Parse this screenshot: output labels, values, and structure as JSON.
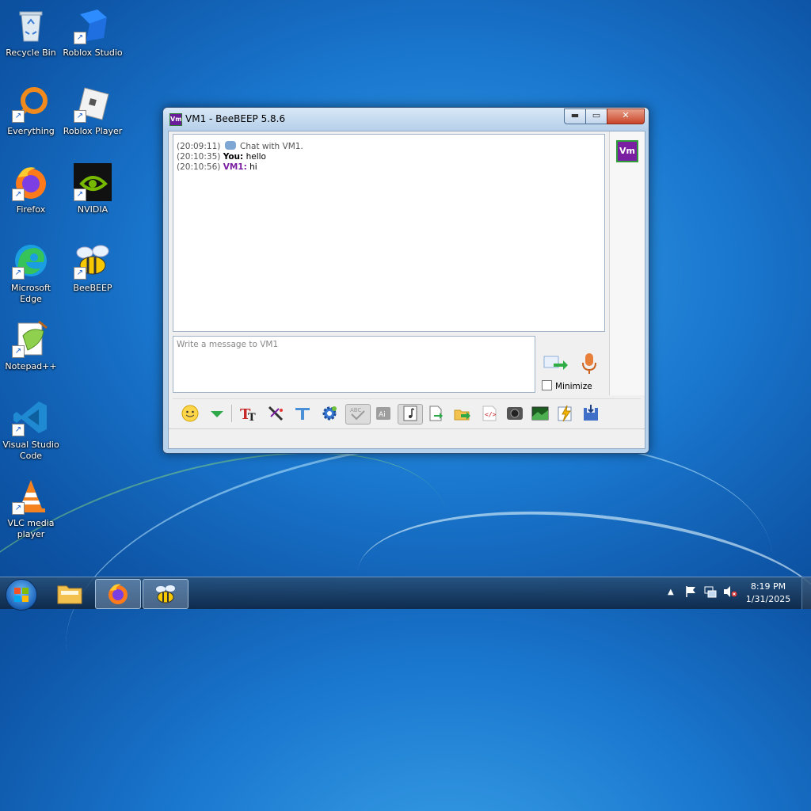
{
  "desktop": {
    "icons": [
      {
        "label": "Recycle Bin"
      },
      {
        "label": "Roblox Studio"
      },
      {
        "label": "Everything"
      },
      {
        "label": "Roblox Player"
      },
      {
        "label": "Firefox"
      },
      {
        "label": "NVIDIA"
      },
      {
        "label": "Microsoft Edge"
      },
      {
        "label": "BeeBEEP"
      },
      {
        "label": "Notepad++"
      },
      {
        "label": "Visual Studio Code"
      },
      {
        "label": "VLC media player"
      }
    ]
  },
  "window": {
    "title": "VM1 - BeeBEEP 5.8.6",
    "title_icon": "Vm",
    "min_glyph": "▬",
    "max_glyph": "▭",
    "close_glyph": "✕",
    "chat": {
      "system": {
        "time": "(20:09:11)",
        "text": "Chat with VM1."
      },
      "messages": [
        {
          "time": "(20:10:35)",
          "sender": "You:",
          "text": "hello"
        },
        {
          "time": "(20:10:56)",
          "sender": "VM1:",
          "text": "hi"
        }
      ]
    },
    "avatar_label": "Vm",
    "input_placeholder": "Write a message to VM1",
    "minimize_label": "Minimize",
    "minimize_checked": false
  },
  "toolbar_icons": [
    "smiley-icon",
    "dropdown-arrow-icon",
    "font-icon",
    "color-pencil-icon",
    "filter-icon",
    "settings-icon",
    "spellcheck-icon",
    "ai-icon",
    "music-note-icon",
    "send-file-icon",
    "send-folder-icon",
    "code-icon",
    "camera-icon",
    "screenshot-icon",
    "lightning-icon",
    "save-chat-icon"
  ],
  "taskbar": {
    "clock_time": "8:19 PM",
    "clock_date": "1/31/2025"
  }
}
